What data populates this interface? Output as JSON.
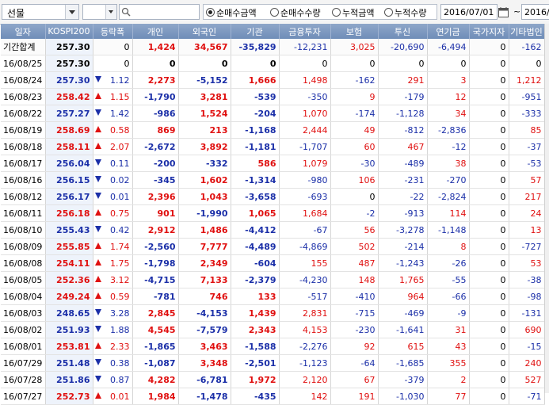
{
  "toolbar": {
    "market": "선물",
    "radio_options": [
      "순매수금액",
      "순매수수량",
      "누적금액",
      "누적수량"
    ],
    "selected_radio": 0,
    "date_from": "2016/07/01",
    "date_separator": "~",
    "date_to": "2016/"
  },
  "table": {
    "headers": [
      "일자",
      "KOSPI200",
      "등락폭",
      "개인",
      "외국인",
      "기관",
      "금융투자",
      "보험",
      "투신",
      "연기금",
      "국가지자",
      "기타법인"
    ],
    "rows": [
      {
        "date": "기간합계",
        "k": "257.30",
        "dir": "",
        "chg": "0",
        "c": [
          "1,424",
          "34,567",
          "-35,829",
          "-12,231",
          "3,025",
          "-20,690",
          "-6,494",
          "0",
          "-162"
        ],
        "total": true
      },
      {
        "date": "16/08/25",
        "k": "257.30",
        "dir": "",
        "chg": "0",
        "c": [
          "0",
          "0",
          "0",
          "0",
          "0",
          "0",
          "0",
          "0",
          "0"
        ]
      },
      {
        "date": "16/08/24",
        "k": "257.30",
        "dir": "down",
        "chg": "1.12",
        "c": [
          "2,273",
          "-5,152",
          "1,666",
          "1,498",
          "-162",
          "291",
          "3",
          "0",
          "1,212"
        ]
      },
      {
        "date": "16/08/23",
        "k": "258.42",
        "dir": "up",
        "chg": "1.15",
        "c": [
          "-1,790",
          "3,281",
          "-539",
          "-350",
          "9",
          "-179",
          "12",
          "0",
          "-951"
        ]
      },
      {
        "date": "16/08/22",
        "k": "257.27",
        "dir": "down",
        "chg": "1.42",
        "c": [
          "-986",
          "1,524",
          "-204",
          "1,070",
          "-174",
          "-1,128",
          "34",
          "0",
          "-333"
        ]
      },
      {
        "date": "16/08/19",
        "k": "258.69",
        "dir": "up",
        "chg": "0.58",
        "c": [
          "869",
          "213",
          "-1,168",
          "2,444",
          "49",
          "-812",
          "-2,836",
          "0",
          "85"
        ]
      },
      {
        "date": "16/08/18",
        "k": "258.11",
        "dir": "up",
        "chg": "2.07",
        "c": [
          "-2,672",
          "3,892",
          "-1,181",
          "-1,707",
          "60",
          "467",
          "-12",
          "0",
          "-37"
        ]
      },
      {
        "date": "16/08/17",
        "k": "256.04",
        "dir": "down",
        "chg": "0.11",
        "c": [
          "-200",
          "-332",
          "586",
          "1,079",
          "-30",
          "-489",
          "38",
          "0",
          "-53"
        ]
      },
      {
        "date": "16/08/16",
        "k": "256.15",
        "dir": "down",
        "chg": "0.02",
        "c": [
          "-345",
          "1,602",
          "-1,314",
          "-980",
          "106",
          "-231",
          "-270",
          "0",
          "57"
        ]
      },
      {
        "date": "16/08/12",
        "k": "256.17",
        "dir": "down",
        "chg": "0.01",
        "c": [
          "2,396",
          "1,043",
          "-3,658",
          "-693",
          "0",
          "-22",
          "-2,824",
          "0",
          "217"
        ]
      },
      {
        "date": "16/08/11",
        "k": "256.18",
        "dir": "up",
        "chg": "0.75",
        "c": [
          "901",
          "-1,990",
          "1,065",
          "1,684",
          "-2",
          "-913",
          "114",
          "0",
          "24"
        ]
      },
      {
        "date": "16/08/10",
        "k": "255.43",
        "dir": "down",
        "chg": "0.42",
        "c": [
          "2,912",
          "1,486",
          "-4,412",
          "-67",
          "56",
          "-3,278",
          "-1,148",
          "0",
          "13"
        ]
      },
      {
        "date": "16/08/09",
        "k": "255.85",
        "dir": "up",
        "chg": "1.74",
        "c": [
          "-2,560",
          "7,777",
          "-4,489",
          "-4,869",
          "502",
          "-214",
          "8",
          "0",
          "-727"
        ]
      },
      {
        "date": "16/08/08",
        "k": "254.11",
        "dir": "up",
        "chg": "1.75",
        "c": [
          "-1,798",
          "2,349",
          "-604",
          "155",
          "487",
          "-1,243",
          "-26",
          "0",
          "53"
        ]
      },
      {
        "date": "16/08/05",
        "k": "252.36",
        "dir": "up",
        "chg": "3.12",
        "c": [
          "-4,715",
          "7,133",
          "-2,379",
          "-4,230",
          "148",
          "1,765",
          "-55",
          "0",
          "-38"
        ]
      },
      {
        "date": "16/08/04",
        "k": "249.24",
        "dir": "up",
        "chg": "0.59",
        "c": [
          "-781",
          "746",
          "133",
          "-517",
          "-410",
          "964",
          "-66",
          "0",
          "-98"
        ]
      },
      {
        "date": "16/08/03",
        "k": "248.65",
        "dir": "down",
        "chg": "3.28",
        "c": [
          "2,845",
          "-4,153",
          "1,439",
          "2,831",
          "-715",
          "-469",
          "-9",
          "0",
          "-131"
        ]
      },
      {
        "date": "16/08/02",
        "k": "251.93",
        "dir": "down",
        "chg": "1.88",
        "c": [
          "4,545",
          "-7,579",
          "2,343",
          "4,153",
          "-230",
          "-1,641",
          "31",
          "0",
          "690"
        ]
      },
      {
        "date": "16/08/01",
        "k": "253.81",
        "dir": "up",
        "chg": "2.33",
        "c": [
          "-1,865",
          "3,463",
          "-1,588",
          "-2,276",
          "92",
          "615",
          "43",
          "0",
          "-15"
        ]
      },
      {
        "date": "16/07/29",
        "k": "251.48",
        "dir": "down",
        "chg": "0.38",
        "c": [
          "-1,087",
          "3,348",
          "-2,501",
          "-1,123",
          "-64",
          "-1,685",
          "355",
          "0",
          "240"
        ]
      },
      {
        "date": "16/07/28",
        "k": "251.86",
        "dir": "down",
        "chg": "0.87",
        "c": [
          "4,282",
          "-6,781",
          "1,972",
          "2,120",
          "67",
          "-379",
          "2",
          "0",
          "527"
        ]
      },
      {
        "date": "16/07/27",
        "k": "252.73",
        "dir": "up",
        "chg": "0.01",
        "c": [
          "1,984",
          "-1,478",
          "-435",
          "142",
          "191",
          "-1,030",
          "77",
          "0",
          "-71"
        ]
      }
    ]
  },
  "colors": {
    "up": "#e01010",
    "down": "#1b2fa8",
    "header_bg": "#7f9ac1"
  }
}
